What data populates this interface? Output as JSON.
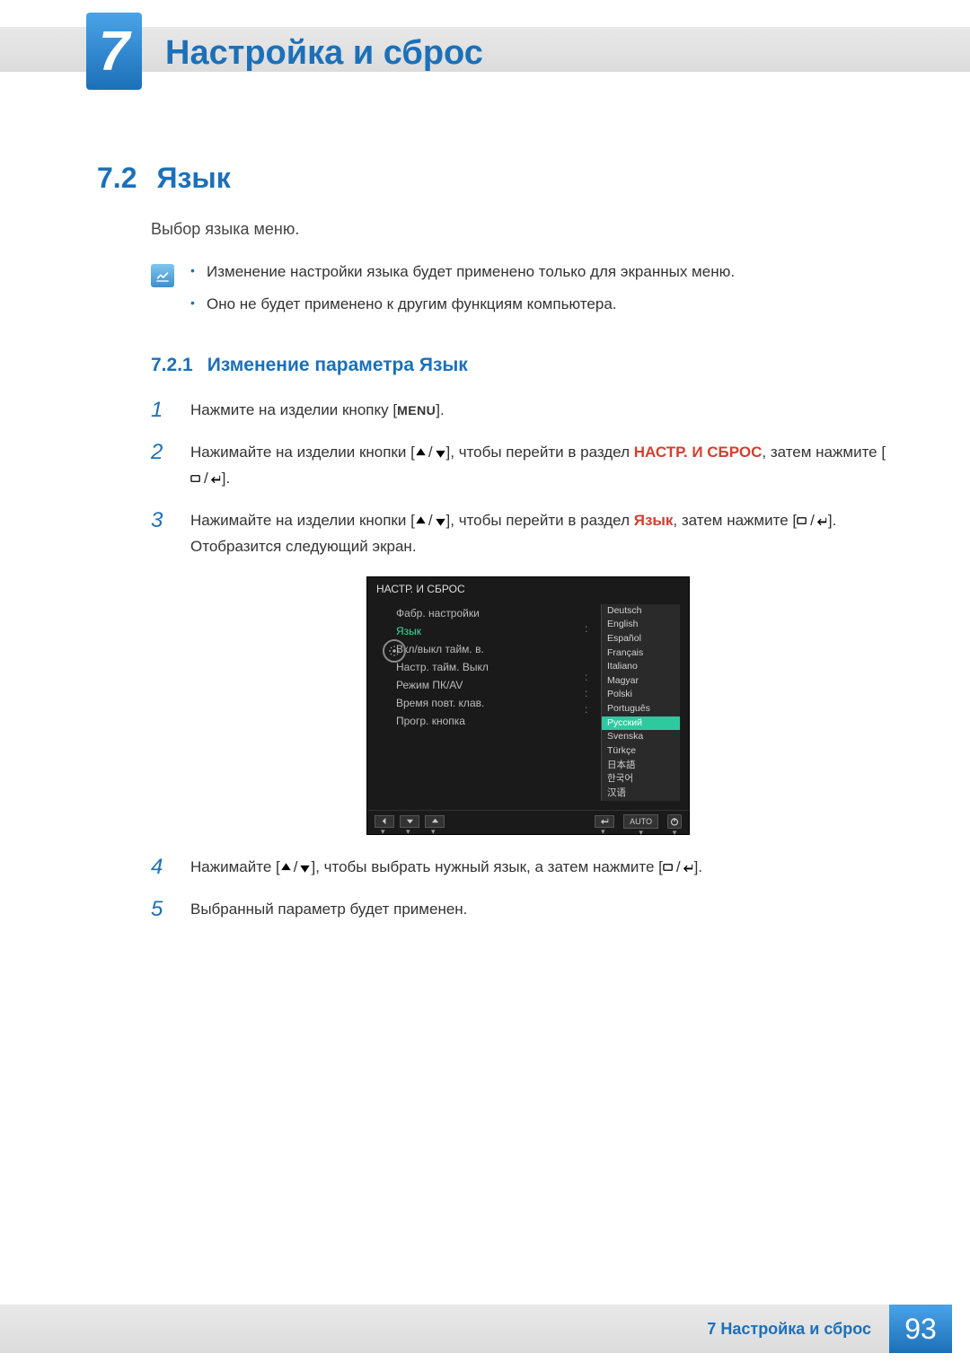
{
  "chapter": {
    "number": "7",
    "title": "Настройка и сброс"
  },
  "section": {
    "number": "7.2",
    "title": "Язык"
  },
  "intro": "Выбор языка меню.",
  "notes": [
    "Изменение настройки языка будет применено только для экранных меню.",
    "Оно не будет применено к другим функциям компьютера."
  ],
  "subsection": {
    "number": "7.2.1",
    "title": "Изменение параметра Язык"
  },
  "steps": {
    "s1_a": "Нажмите на изделии кнопку [",
    "menu_label": "MENU",
    "s1_b": "].",
    "s2_a": "Нажимайте на изделии кнопки [",
    "s2_b": "], чтобы перейти в раздел ",
    "s2_strong": "НАСТР. И СБРОС",
    "s2_c": ", затем нажмите [",
    "s2_d": "].",
    "s3_a": "Нажимайте на изделии кнопки [",
    "s3_b": "], чтобы перейти в раздел ",
    "s3_strong": "Язык",
    "s3_c": ", затем нажмите [",
    "s3_d": "]. Отобразится следующий экран.",
    "s4_a": "Нажимайте [",
    "s4_b": "], чтобы выбрать нужный язык, а затем нажмите [",
    "s4_c": "].",
    "s5": "Выбранный параметр будет применен."
  },
  "osd": {
    "title": "НАСТР. И СБРОС",
    "left_items": [
      "Фабр. настройки",
      "Язык",
      "Вкл/выкл тайм. в.",
      "Настр. тайм. Выкл",
      "Режим ПК/AV",
      "Время повт. клав.",
      "Прогр. кнопка"
    ],
    "selected_index": 1,
    "languages": [
      "Deutsch",
      "English",
      "Español",
      "Français",
      "Italiano",
      "Magyar",
      "Polski",
      "Português",
      "Русский",
      "Svenska",
      "Türkçe",
      "日本語",
      "한국어",
      "汉语"
    ],
    "highlight_lang_index": 8,
    "auto_label": "AUTO"
  },
  "footer": {
    "chapter_label": "7 Настройка и сброс",
    "page": "93"
  }
}
